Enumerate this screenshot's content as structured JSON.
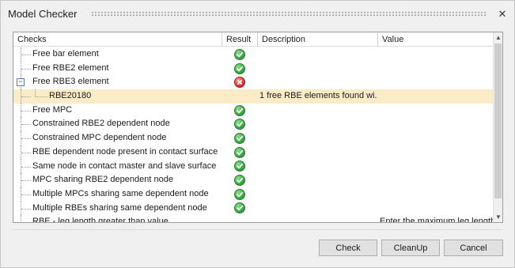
{
  "window": {
    "title": "Model Checker",
    "close_glyph": "✕"
  },
  "table": {
    "columns": [
      "Checks",
      "Result",
      "Description",
      "Value"
    ],
    "rows": [
      {
        "check": "Free bar element",
        "result": "ok",
        "description": "",
        "value": ""
      },
      {
        "check": "Free RBE2 element",
        "result": "ok",
        "description": "",
        "value": ""
      },
      {
        "check": "Free RBE3 element",
        "result": "error",
        "description": "",
        "value": "",
        "expanded": true,
        "expander_glyph": "−"
      },
      {
        "check": "RBE20180",
        "result": "",
        "description": "1 free RBE elements found wi...",
        "value": "",
        "child": true,
        "selected": true
      },
      {
        "check": "Free MPC",
        "result": "ok",
        "description": "",
        "value": ""
      },
      {
        "check": "Constrained RBE2 dependent node",
        "result": "ok",
        "description": "",
        "value": ""
      },
      {
        "check": "Constrained MPC dependent node",
        "result": "ok",
        "description": "",
        "value": ""
      },
      {
        "check": "RBE dependent node present in contact surface",
        "result": "ok",
        "description": "",
        "value": ""
      },
      {
        "check": "Same node in contact master and slave surface",
        "result": "ok",
        "description": "",
        "value": ""
      },
      {
        "check": "MPC sharing RBE2 dependent node",
        "result": "ok",
        "description": "",
        "value": ""
      },
      {
        "check": "Multiple MPCs sharing same dependent node",
        "result": "ok",
        "description": "",
        "value": ""
      },
      {
        "check": "Multiple RBEs sharing same dependent node",
        "result": "ok",
        "description": "",
        "value": ""
      },
      {
        "check": "RBE - leg length greater than value",
        "result": "",
        "description": "",
        "value": "Enter the maximum leg length"
      }
    ]
  },
  "buttons": {
    "check": "Check",
    "cleanup": "CleanUp",
    "cancel": "Cancel"
  },
  "colors": {
    "selected_row": "#fbecc8",
    "ok": "#2f9e3a",
    "error": "#d02c2c"
  },
  "icons": {
    "ok": "green-check-circle-icon",
    "error": "red-x-circle-icon",
    "scroll_up": "▲",
    "scroll_down": "▼"
  }
}
